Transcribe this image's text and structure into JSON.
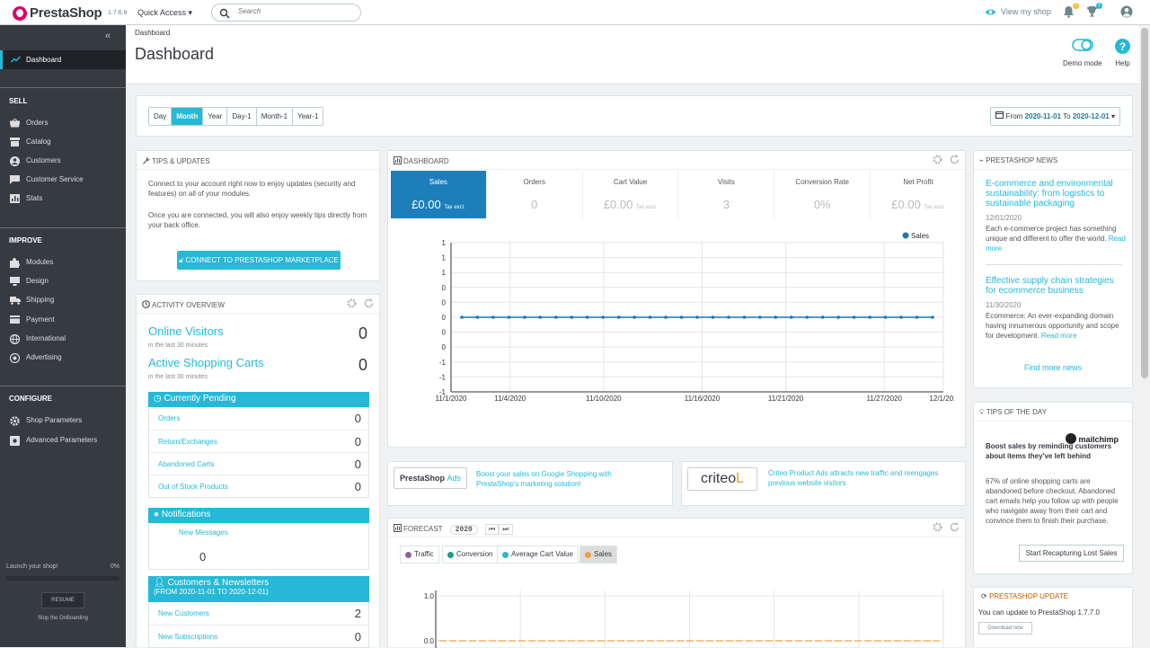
{
  "app": {
    "brand": "PrestaShop",
    "version": "1.7.6.9",
    "quick_access": "Quick Access",
    "search_placeholder": "Search",
    "view_shop": "View my shop",
    "notif_orders": "0",
    "notif_customers": "1"
  },
  "sidebar": {
    "active": "Dashboard",
    "sell": {
      "title": "SELL",
      "items": [
        "Orders",
        "Catalog",
        "Customers",
        "Customer Service",
        "Stats"
      ]
    },
    "improve": {
      "title": "IMPROVE",
      "items": [
        "Modules",
        "Design",
        "Shipping",
        "Payment",
        "International",
        "Advertising"
      ]
    },
    "configure": {
      "title": "CONFIGURE",
      "items": [
        "Shop Parameters",
        "Advanced Parameters"
      ]
    },
    "launch": "Launch your shop!",
    "launch_pct": "0%",
    "resume": "RESUME",
    "stop": "Stop the OnBoarding"
  },
  "header": {
    "breadcrumb": "Dashboard",
    "title": "Dashboard",
    "demo": "Demo mode",
    "help": "Help"
  },
  "range": {
    "buttons": [
      "Day",
      "Month",
      "Year",
      "Day-1",
      "Month-1",
      "Year-1"
    ],
    "active": "Month",
    "from_label": "From",
    "from": "2020-11-01",
    "to_label": "To",
    "to": "2020-12-01"
  },
  "tips": {
    "title": "TIPS & UPDATES",
    "p1": "Connect to your account right now to enjoy updates (security and features) on all of your modules.",
    "p2": "Once you are connected, you will also enjoy weekly tips directly from your back office.",
    "button": "CONNECT TO PRESTASHOP MARKETPLACE"
  },
  "activity": {
    "title": "ACTIVITY OVERVIEW",
    "visitors": "Online Visitors",
    "visitors_sub": "in the last 30 minutes",
    "visitors_val": "0",
    "carts": "Active Shopping Carts",
    "carts_sub": "in the last 30 minutes",
    "carts_val": "0",
    "pending": {
      "title": "Currently Pending",
      "rows": [
        {
          "label": "Orders",
          "value": "0"
        },
        {
          "label": "Return/Exchanges",
          "value": "0"
        },
        {
          "label": "Abandoned Carts",
          "value": "0"
        },
        {
          "label": "Out of Stock Products",
          "value": "0"
        }
      ]
    },
    "notifications": {
      "title": "Notifications",
      "label": "New Messages",
      "value": "0"
    },
    "customers": {
      "title": "Customers & Newsletters",
      "sub": "(FROM 2020-11-01 TO 2020-12-01)",
      "rows": [
        {
          "label": "New Customers",
          "value": "2"
        },
        {
          "label": "New Subscriptions",
          "value": "0"
        }
      ]
    }
  },
  "dashboard": {
    "title": "DASHBOARD",
    "kpis": [
      {
        "label": "Sales",
        "value": "£0.00",
        "suffix": "Tax excl."
      },
      {
        "label": "Orders",
        "value": "0",
        "suffix": ""
      },
      {
        "label": "Cart Value",
        "value": "£0.00",
        "suffix": "Tax excl."
      },
      {
        "label": "Visits",
        "value": "3",
        "suffix": ""
      },
      {
        "label": "Conversion Rate",
        "value": "0%",
        "suffix": ""
      },
      {
        "label": "Net Profit",
        "value": "£0.00",
        "suffix": "Tax excl."
      }
    ]
  },
  "chart_data": [
    {
      "type": "line",
      "legend": [
        "Sales"
      ],
      "legend_position": "top-right",
      "y_ticks": [
        "1",
        "1",
        "1",
        "0",
        "0",
        "0",
        "0",
        "0",
        "-1",
        "-1",
        "-1"
      ],
      "x_ticks": [
        "11/1/2020",
        "11/4/2020",
        "11/10/2020",
        "11/16/2020",
        "11/21/2020",
        "11/27/2020",
        "12/1/202"
      ],
      "series": [
        {
          "name": "Sales",
          "values": [
            0,
            0,
            0,
            0,
            0,
            0,
            0,
            0,
            0,
            0,
            0,
            0,
            0,
            0,
            0,
            0,
            0,
            0,
            0,
            0,
            0,
            0,
            0,
            0,
            0,
            0,
            0,
            0,
            0,
            0,
            0
          ]
        }
      ],
      "grid": true
    },
    {
      "type": "line",
      "title": "FORECAST",
      "year": "2020",
      "legend": [
        "Traffic",
        "Conversion",
        "Average Cart Value",
        "Sales"
      ],
      "y_ticks": [
        "1.0",
        "0.0"
      ],
      "series": [
        {
          "name": "Sales",
          "values": [
            0,
            0,
            0,
            0,
            0,
            0,
            0,
            0,
            0,
            0,
            0,
            0,
            0,
            0,
            0,
            0,
            0,
            0,
            0,
            0,
            0,
            0,
            0,
            0,
            0,
            0,
            0,
            0,
            0,
            0,
            0,
            0,
            0,
            0,
            0,
            0,
            0,
            0,
            0,
            0,
            0,
            0,
            0,
            0,
            0,
            0,
            0,
            0,
            0,
            0,
            0,
            0,
            0,
            0,
            0,
            0
          ]
        }
      ],
      "grid": true
    }
  ],
  "ads": {
    "prestashop_logo": "PrestaShop",
    "prestashop_logo_ads": "Ads",
    "prestashop_text": "Boost your sales on Google Shopping with PrestaShop's marketing solution!",
    "criteo_logo": "criteo",
    "criteo_text": "Criteo Product Ads attracts new traffic and reengages previous website visitors"
  },
  "forecast": {
    "title": "FORECAST",
    "year": "2020",
    "tabs": [
      {
        "label": "Traffic",
        "color": "#8f5fa0"
      },
      {
        "label": "Conversion",
        "color": "#1c9a8c"
      },
      {
        "label": "Average Cart Value",
        "color": "#2fb5d2"
      },
      {
        "label": "Sales",
        "color": "#f0a040"
      }
    ]
  },
  "news": {
    "title": "PRESTASHOP NEWS",
    "items": [
      {
        "title": "E-commerce and environmental sustainability: from logistics to sustainable packaging",
        "date": "12/01/2020",
        "body": "Each e-commerce project has something unique and different to offer the world.",
        "more": "Read more"
      },
      {
        "title": "Effective supply chain strategies for ecommerce business",
        "date": "11/30/2020",
        "body": "Ecommerce: An ever-expanding domain having innumerous opportunity and scope for development.",
        "more": "Read more"
      }
    ],
    "find_more": "Find more news"
  },
  "tipday": {
    "title": "TIPS OF THE DAY",
    "logo": "mailchimp",
    "headline": "Boost sales by reminding customers about items they've left behind",
    "body": "67% of online shopping carts are abandoned before checkout. Abandoned cart emails help you follow up with people who navigate away from their cart and convince them to finish their purchase.",
    "button": "Start Recapturing Lost Sales"
  },
  "update": {
    "title": "PRESTASHOP UPDATE",
    "text": "You can update to PrestaShop 1.7.7.0",
    "button": "Download now"
  }
}
